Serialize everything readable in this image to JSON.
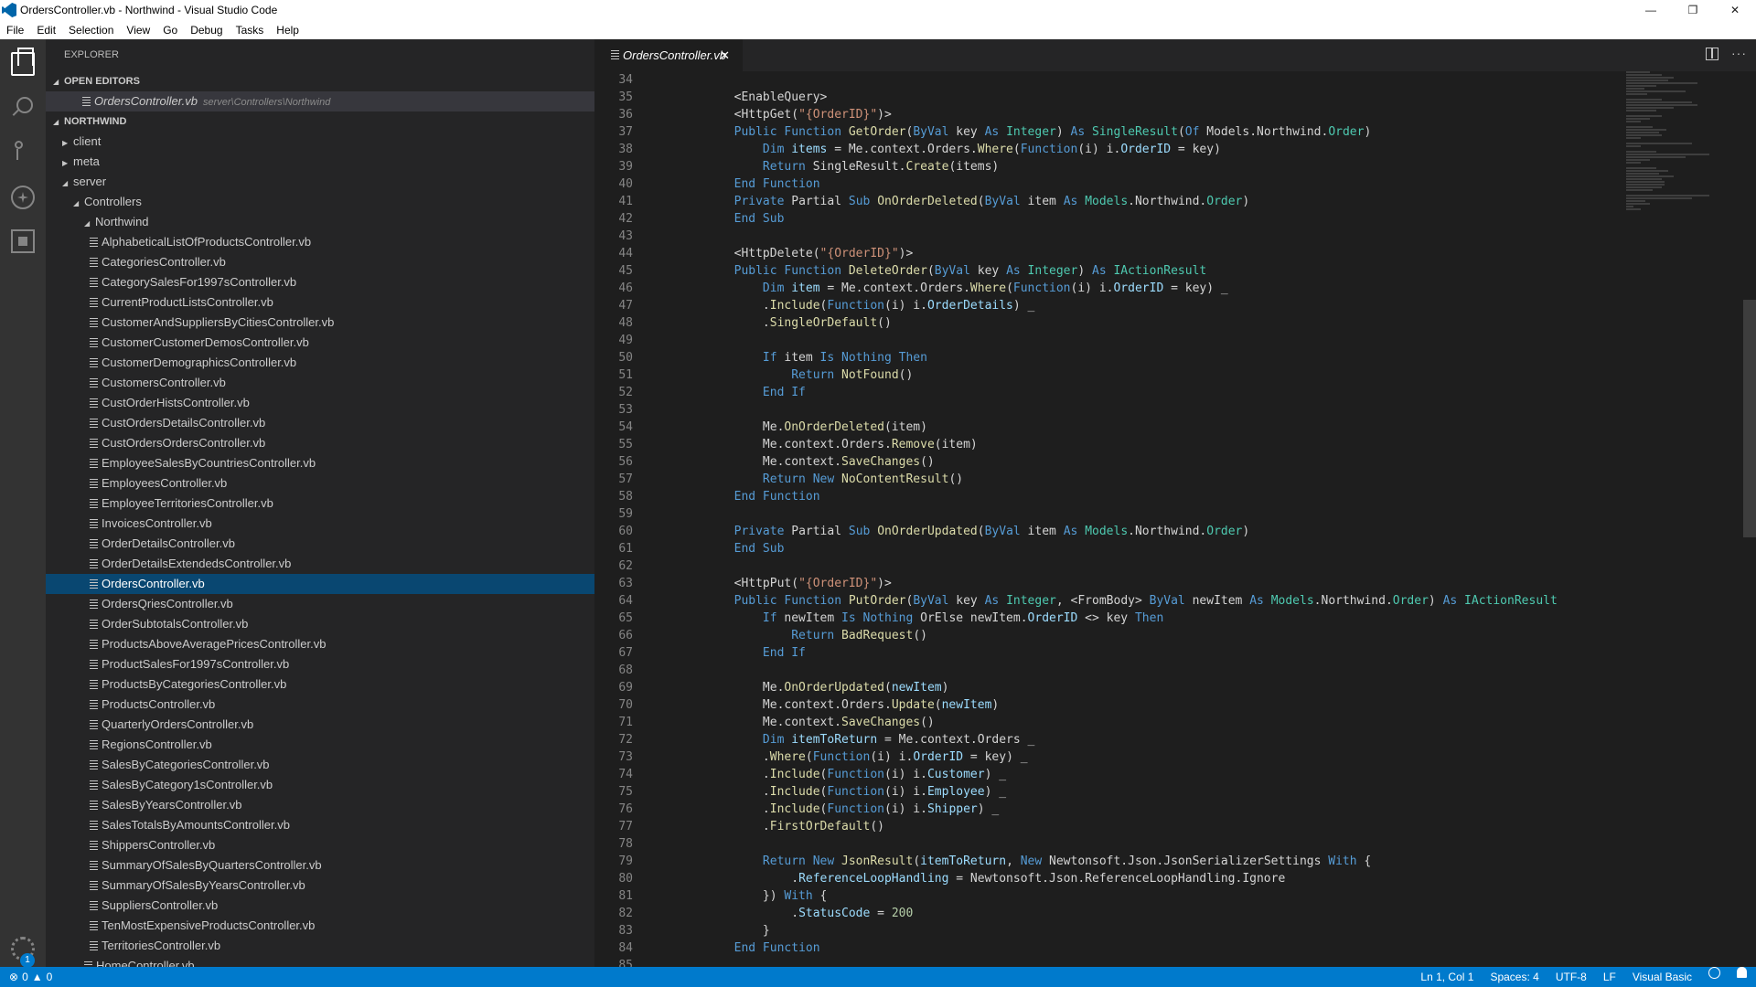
{
  "window": {
    "title": "OrdersController.vb - Northwind - Visual Studio Code",
    "controls": [
      "—",
      "❐",
      "✕"
    ]
  },
  "menu": [
    "File",
    "Edit",
    "Selection",
    "View",
    "Go",
    "Debug",
    "Tasks",
    "Help"
  ],
  "activity": {
    "badge": "1",
    "icons": [
      "explorer-icon",
      "search-icon",
      "source-control-icon",
      "debug-icon",
      "extensions-icon",
      "gear-icon"
    ]
  },
  "sidebar": {
    "title": "EXPLORER",
    "open_editors_label": "OPEN EDITORS",
    "open_editor": {
      "name": "OrdersController.vb",
      "path": "server\\Controllers\\Northwind"
    },
    "workspace_label": "NORTHWIND",
    "folders": {
      "client": "client",
      "meta": "meta",
      "server": "server",
      "controllers": "Controllers",
      "northwind": "Northwind"
    },
    "files": [
      "AlphabeticalListOfProductsController.vb",
      "CategoriesController.vb",
      "CategorySalesFor1997sController.vb",
      "CurrentProductListsController.vb",
      "CustomerAndSuppliersByCitiesController.vb",
      "CustomerCustomerDemosController.vb",
      "CustomerDemographicsController.vb",
      "CustomersController.vb",
      "CustOrderHistsController.vb",
      "CustOrdersDetailsController.vb",
      "CustOrdersOrdersController.vb",
      "EmployeeSalesByCountriesController.vb",
      "EmployeesController.vb",
      "EmployeeTerritoriesController.vb",
      "InvoicesController.vb",
      "OrderDetailsController.vb",
      "OrderDetailsExtendedsController.vb",
      "OrdersController.vb",
      "OrdersQriesController.vb",
      "OrderSubtotalsController.vb",
      "ProductsAboveAveragePricesController.vb",
      "ProductSalesFor1997sController.vb",
      "ProductsByCategoriesController.vb",
      "ProductsController.vb",
      "QuarterlyOrdersController.vb",
      "RegionsController.vb",
      "SalesByCategoriesController.vb",
      "SalesByCategory1sController.vb",
      "SalesByYearsController.vb",
      "SalesTotalsByAmountsController.vb",
      "ShippersController.vb",
      "SummaryOfSalesByQuartersController.vb",
      "SummaryOfSalesByYearsController.vb",
      "SuppliersController.vb",
      "TenMostExpensiveProductsController.vb",
      "TerritoriesController.vb"
    ],
    "selected_file": "OrdersController.vb",
    "partial_last": "HomeController.vb"
  },
  "editor": {
    "tab_label": "OrdersController.vb",
    "tab_close": "✕",
    "lines": [
      {
        "n": "34",
        "html": ""
      },
      {
        "n": "35",
        "html": "        &lt;EnableQuery&gt;"
      },
      {
        "n": "36",
        "html": "        &lt;HttpGet(<span class=\"s\">\"{OrderID}\"</span>)&gt;"
      },
      {
        "n": "37",
        "html": "        <span class=\"k\">Public Function</span> <span class=\"f\">GetOrder</span>(<span class=\"k\">ByVal</span> key <span class=\"k\">As</span> <span class=\"t\">Integer</span>) <span class=\"k\">As</span> <span class=\"t\">SingleResult</span>(<span class=\"k\">Of</span> Models.Northwind.<span class=\"t\">Order</span>)"
      },
      {
        "n": "38",
        "html": "            <span class=\"k\">Dim</span> <span class=\"v\">items</span> = Me.context.Orders.<span class=\"f\">Where</span>(<span class=\"k\">Function</span>(i) i.<span class=\"v\">OrderID</span> = key)"
      },
      {
        "n": "39",
        "html": "            <span class=\"k\">Return</span> SingleResult.<span class=\"f\">Create</span>(items)"
      },
      {
        "n": "40",
        "html": "        <span class=\"k\">End Function</span>"
      },
      {
        "n": "41",
        "html": "        <span class=\"k\">Private</span> Partial <span class=\"k\">Sub</span> <span class=\"f\">OnOrderDeleted</span>(<span class=\"k\">ByVal</span> item <span class=\"k\">As</span> <span class=\"t\">Models</span>.Northwind.<span class=\"t\">Order</span>)"
      },
      {
        "n": "42",
        "html": "        <span class=\"k\">End Sub</span>"
      },
      {
        "n": "43",
        "html": ""
      },
      {
        "n": "44",
        "html": "        &lt;HttpDelete(<span class=\"s\">\"{OrderID}\"</span>)&gt;"
      },
      {
        "n": "45",
        "html": "        <span class=\"k\">Public Function</span> <span class=\"f\">DeleteOrder</span>(<span class=\"k\">ByVal</span> key <span class=\"k\">As</span> <span class=\"t\">Integer</span>) <span class=\"k\">As</span> <span class=\"t\">IActionResult</span>"
      },
      {
        "n": "46",
        "html": "            <span class=\"k\">Dim</span> <span class=\"v\">item</span> = Me.context.Orders.<span class=\"f\">Where</span>(<span class=\"k\">Function</span>(i) i.<span class=\"v\">OrderID</span> = key) _"
      },
      {
        "n": "47",
        "html": "            .<span class=\"f\">Include</span>(<span class=\"k\">Function</span>(i) i.<span class=\"v\">OrderDetails</span>) _"
      },
      {
        "n": "48",
        "html": "            .<span class=\"f\">SingleOrDefault</span>()"
      },
      {
        "n": "49",
        "html": ""
      },
      {
        "n": "50",
        "html": "            <span class=\"k\">If</span> item <span class=\"k\">Is</span> <span class=\"k\">Nothing</span> <span class=\"k\">Then</span>"
      },
      {
        "n": "51",
        "html": "                <span class=\"k\">Return</span> <span class=\"f\">NotFound</span>()"
      },
      {
        "n": "52",
        "html": "            <span class=\"k\">End If</span>"
      },
      {
        "n": "53",
        "html": ""
      },
      {
        "n": "54",
        "html": "            Me.<span class=\"f\">OnOrderDeleted</span>(item)"
      },
      {
        "n": "55",
        "html": "            Me.context.Orders.<span class=\"f\">Remove</span>(item)"
      },
      {
        "n": "56",
        "html": "            Me.context.<span class=\"f\">SaveChanges</span>()"
      },
      {
        "n": "57",
        "html": "            <span class=\"k\">Return New</span> <span class=\"f\">NoContentResult</span>()"
      },
      {
        "n": "58",
        "html": "        <span class=\"k\">End Function</span>"
      },
      {
        "n": "59",
        "html": ""
      },
      {
        "n": "60",
        "html": "        <span class=\"k\">Private</span> Partial <span class=\"k\">Sub</span> <span class=\"f\">OnOrderUpdated</span>(<span class=\"k\">ByVal</span> item <span class=\"k\">As</span> <span class=\"t\">Models</span>.Northwind.<span class=\"t\">Order</span>)"
      },
      {
        "n": "61",
        "html": "        <span class=\"k\">End Sub</span>"
      },
      {
        "n": "62",
        "html": ""
      },
      {
        "n": "63",
        "html": "        &lt;HttpPut(<span class=\"s\">\"{OrderID}\"</span>)&gt;"
      },
      {
        "n": "64",
        "html": "        <span class=\"k\">Public Function</span> <span class=\"f\">PutOrder</span>(<span class=\"k\">ByVal</span> key <span class=\"k\">As</span> <span class=\"t\">Integer</span>, &lt;FromBody&gt; <span class=\"k\">ByVal</span> newItem <span class=\"k\">As</span> <span class=\"t\">Models</span>.Northwind.<span class=\"t\">Order</span>) <span class=\"k\">As</span> <span class=\"t\">IActionResult</span>"
      },
      {
        "n": "65",
        "html": "            <span class=\"k\">If</span> newItem <span class=\"k\">Is</span> <span class=\"k\">Nothing</span> OrElse newItem.<span class=\"v\">OrderID</span> &lt;&gt; key <span class=\"k\">Then</span>"
      },
      {
        "n": "66",
        "html": "                <span class=\"k\">Return</span> <span class=\"f\">BadRequest</span>()"
      },
      {
        "n": "67",
        "html": "            <span class=\"k\">End If</span>"
      },
      {
        "n": "68",
        "html": ""
      },
      {
        "n": "69",
        "html": "            Me.<span class=\"f\">OnOrderUpdated</span>(<span class=\"v\">newItem</span>)"
      },
      {
        "n": "70",
        "html": "            Me.context.Orders.<span class=\"f\">Update</span>(<span class=\"v\">newItem</span>)"
      },
      {
        "n": "71",
        "html": "            Me.context.<span class=\"f\">SaveChanges</span>()"
      },
      {
        "n": "72",
        "html": "            <span class=\"k\">Dim</span> <span class=\"v\">itemToReturn</span> = Me.context.Orders _"
      },
      {
        "n": "73",
        "html": "            .<span class=\"f\">Where</span>(<span class=\"k\">Function</span>(i) i.<span class=\"v\">OrderID</span> = key) _"
      },
      {
        "n": "74",
        "html": "            .<span class=\"f\">Include</span>(<span class=\"k\">Function</span>(i) i.<span class=\"v\">Customer</span>) _"
      },
      {
        "n": "75",
        "html": "            .<span class=\"f\">Include</span>(<span class=\"k\">Function</span>(i) i.<span class=\"v\">Employee</span>) _"
      },
      {
        "n": "76",
        "html": "            .<span class=\"f\">Include</span>(<span class=\"k\">Function</span>(i) i.<span class=\"v\">Shipper</span>) _"
      },
      {
        "n": "77",
        "html": "            .<span class=\"f\">FirstOrDefault</span>()"
      },
      {
        "n": "78",
        "html": ""
      },
      {
        "n": "79",
        "html": "            <span class=\"k\">Return New</span> <span class=\"f\">JsonResult</span>(<span class=\"v\">itemToReturn</span>, <span class=\"k\">New</span> Newtonsoft.Json.JsonSerializerSettings <span class=\"k\">With</span> {"
      },
      {
        "n": "80",
        "html": "                .<span class=\"v\">ReferenceLoopHandling</span> = Newtonsoft.Json.ReferenceLoopHandling.Ignore"
      },
      {
        "n": "81",
        "html": "            }) <span class=\"k\">With</span> {"
      },
      {
        "n": "82",
        "html": "                .<span class=\"v\">StatusCode</span> = <span class=\"n\">200</span>"
      },
      {
        "n": "83",
        "html": "            }"
      },
      {
        "n": "84",
        "html": "        <span class=\"k\">End Function</span>"
      },
      {
        "n": "85",
        "html": ""
      }
    ]
  },
  "status": {
    "errors": "0",
    "warnings": "0",
    "position": "Ln 1, Col 1",
    "spaces": "Spaces: 4",
    "encoding": "UTF-8",
    "eol": "LF",
    "language": "Visual Basic"
  }
}
